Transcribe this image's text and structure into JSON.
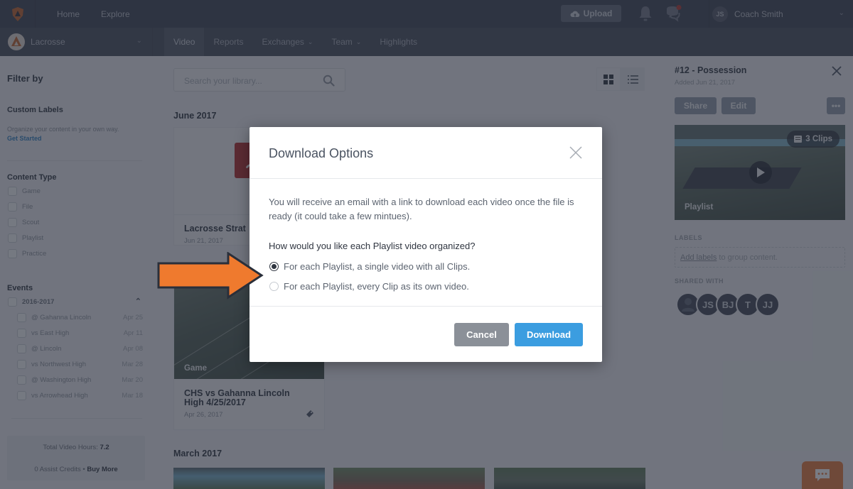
{
  "topbar": {
    "nav": [
      "Home",
      "Explore"
    ],
    "upload_label": "Upload",
    "user_initials": "JS",
    "user_name": "Coach Smith"
  },
  "subbar": {
    "team_name": "Lacrosse",
    "tabs": [
      {
        "label": "Video",
        "active": true
      },
      {
        "label": "Reports"
      },
      {
        "label": "Exchanges",
        "dropdown": true
      },
      {
        "label": "Team",
        "dropdown": true
      },
      {
        "label": "Highlights"
      }
    ]
  },
  "sidebar": {
    "title": "Filter by",
    "custom_labels": {
      "heading": "Custom Labels",
      "description": "Organize your content in your own way.",
      "link": "Get Started"
    },
    "content_type": {
      "heading": "Content Type",
      "options": [
        "Game",
        "File",
        "Scout",
        "Playlist",
        "Practice"
      ]
    },
    "events": {
      "heading": "Events",
      "season": "2016-2017",
      "items": [
        {
          "name": "@ Gahanna Lincoln",
          "date": "Apr 25"
        },
        {
          "name": "vs East High",
          "date": "Apr 11"
        },
        {
          "name": "@ Lincoln",
          "date": "Apr 08"
        },
        {
          "name": "vs Northwest High",
          "date": "Mar 28"
        },
        {
          "name": "@ Washington High",
          "date": "Mar 20"
        },
        {
          "name": "vs Arrowhead High",
          "date": "Mar 18"
        }
      ]
    },
    "stats": {
      "hours_label": "Total Video Hours:",
      "hours_value": "7.2",
      "credits": "0 Assist Credits",
      "separator": "•",
      "buy_more": "Buy More"
    }
  },
  "main": {
    "search_placeholder": "Search your library...",
    "sections": [
      {
        "month": "June 2017",
        "cards": [
          {
            "title": "Lacrosse Strat",
            "date": "Jun 21, 2017",
            "type": "pdf"
          },
          {
            "title": "CHS vs Gahanna Lincoln High 4/25/2017",
            "title_line1": "CHS vs Gahanna Lincoln",
            "title_line2": "High 4/25/2017",
            "date": "Apr 26, 2017",
            "thumb_label": "Game"
          }
        ]
      },
      {
        "month": "March 2017"
      }
    ]
  },
  "right_panel": {
    "title": "#12 - Possession",
    "added": "Added Jun 21, 2017",
    "share_label": "Share",
    "edit_label": "Edit",
    "more_label": "•••",
    "clips_label": "3 Clips",
    "thumb_label": "Playlist",
    "labels_heading": "LABELS",
    "labels_link": "Add labels",
    "labels_rest": " to group content.",
    "shared_heading": "SHARED WITH",
    "shared_with": [
      "JS",
      "BJ",
      "T",
      "JJ"
    ]
  },
  "modal": {
    "title": "Download Options",
    "description": "You will receive an email with a link to download each video once the file is ready (it could take a few mintues).",
    "question": "How would you like each Playlist video organized?",
    "options": [
      {
        "label": "For each Playlist, a single video with all Clips.",
        "checked": true
      },
      {
        "label": "For each Playlist, every Clip as its own video.",
        "checked": false
      }
    ],
    "cancel_label": "Cancel",
    "download_label": "Download"
  },
  "colors": {
    "accent_orange": "#ef7a2e",
    "primary_blue": "#3b9de0",
    "cancel_gray": "#8b9098"
  }
}
